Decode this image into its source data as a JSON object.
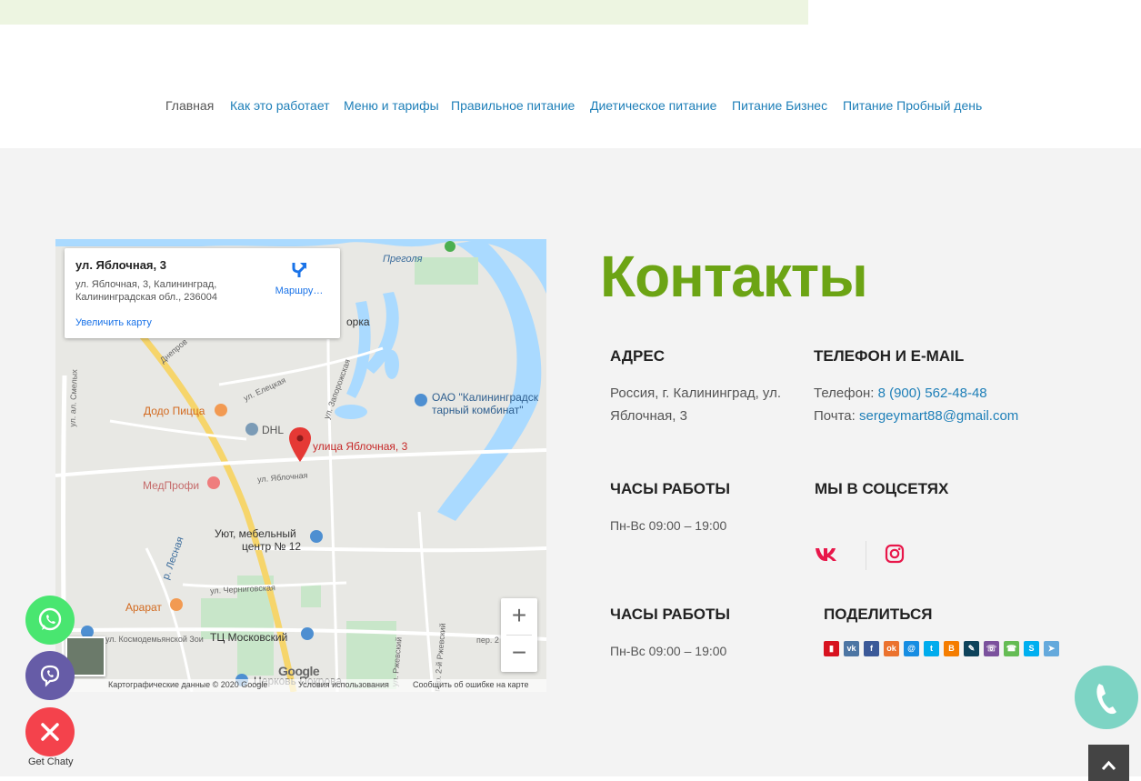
{
  "nav": {
    "items": [
      {
        "label": "Главная"
      },
      {
        "label": "Как это работает"
      },
      {
        "label": "Меню и тарифы"
      },
      {
        "label": "Правильное питание"
      },
      {
        "label": "Диетическое питание"
      },
      {
        "label": "Питание Бизнес"
      },
      {
        "label": "Питание Пробный день"
      }
    ]
  },
  "map": {
    "card_title": "ул. Яблочная, 3",
    "card_address_line1": "ул. Яблочная, 3, Калининград,",
    "card_address_line2": "Калининградская обл., 236004",
    "enlarge_link": "Увеличить карту",
    "route_label": "Маршру…",
    "labels": {
      "pregolya": "Преголя",
      "dodo": "Додо Пицца",
      "dhl": "DHL",
      "target": "улица Яблочная, 3",
      "kombinat1": "ОАО \"Калининградск",
      "kombinat2": "тарный комбинат\"",
      "medprofi": "МедПрофи",
      "uyut1": "Уют, мебельный",
      "uyut2": "центр № 12",
      "ararat": "Арарат",
      "tc": "ТЦ Московский",
      "church": "Церковь Покрова",
      "orka": "орка",
      "street_smelykh": "ул. ал. Смелых",
      "street_lesnaya": "р. Лесная",
      "street_chernigov": "ул. Черниговская",
      "street_kosmodem": "ул. Космодемьянской Зои",
      "street_yablochnaya": "ул. Яблочная",
      "street_rzhevsk": "ул. Ржевский",
      "street_per2": "пер. 2-й Ржевский",
      "street_elets": "ул. Елецкая",
      "street_dnepr": "Днепров",
      "street_zapor": "ул. Запорожская",
      "per2": "пер. 2"
    },
    "zoom_in": "+",
    "zoom_out": "−",
    "google_logo": "Google",
    "attr_data": "Картографические данные © 2020 Google",
    "attr_terms": "Условия использования",
    "attr_report": "Сообщить об ошибке на карте"
  },
  "contacts": {
    "title": "Контакты",
    "address_heading": "АДРЕС",
    "address_text": "Россия, г. Калининград, ул. Яблочная, 3",
    "phone_heading": "ТЕЛЕФОН И E-MAIL",
    "phone_label": "Телефон: ",
    "phone_value": "8 (900) 562-48-48",
    "email_label": "Почта: ",
    "email_value": "sergeymart88@gmail.com",
    "hours_heading": "ЧАСЫ РАБОТЫ",
    "hours_text": "Пн-Вс 09:00 – 19:00",
    "social_heading": "МЫ В СОЦСЕТЯХ",
    "hours_heading_2": "ЧАСЫ РАБОТЫ",
    "hours_text_2": "Пн-Вс 09:00 – 19:00",
    "share_heading": "ПОДЕЛИТЬСЯ",
    "vk_color": "#e8174a",
    "instagram_color": "#e8174a"
  },
  "share_icons": [
    {
      "name": "bookmark-icon",
      "color": "#d7121f"
    },
    {
      "name": "vk-icon",
      "color": "#4c75a3"
    },
    {
      "name": "facebook-icon",
      "color": "#3b5998"
    },
    {
      "name": "odnoklassniki-icon",
      "color": "#eb722e"
    },
    {
      "name": "moimir-icon",
      "color": "#168de2"
    },
    {
      "name": "twitter-icon",
      "color": "#00aced"
    },
    {
      "name": "blogger-icon",
      "color": "#f57d00"
    },
    {
      "name": "livejournal-icon",
      "color": "#0d425a"
    },
    {
      "name": "viber-icon",
      "color": "#7b519d"
    },
    {
      "name": "whatsapp-icon",
      "color": "#65bc54"
    },
    {
      "name": "skype-icon",
      "color": "#00aff0"
    },
    {
      "name": "telegram-icon",
      "color": "#64a9dc"
    }
  ],
  "chaty": {
    "whatsapp_color": "#49e670",
    "viber_color": "#665ca7",
    "close_color": "#f4424c",
    "label": "Get Chaty"
  },
  "accent_green": "#6ca414",
  "link_blue": "#1e7fb8"
}
